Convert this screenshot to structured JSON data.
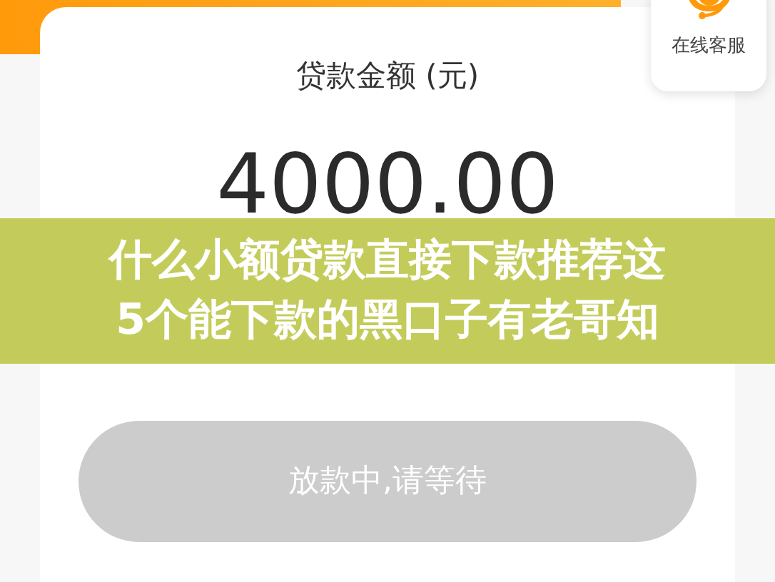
{
  "loan": {
    "label": "贷款金额 (元)",
    "amount": "4000.00"
  },
  "service": {
    "label": "在线客服"
  },
  "button": {
    "label": "放款中,请等待",
    "disabled": true
  },
  "banner": {
    "lines": [
      "什么小额贷款直接下款推荐这",
      "5个能下款的黑口子有老哥知"
    ]
  }
}
